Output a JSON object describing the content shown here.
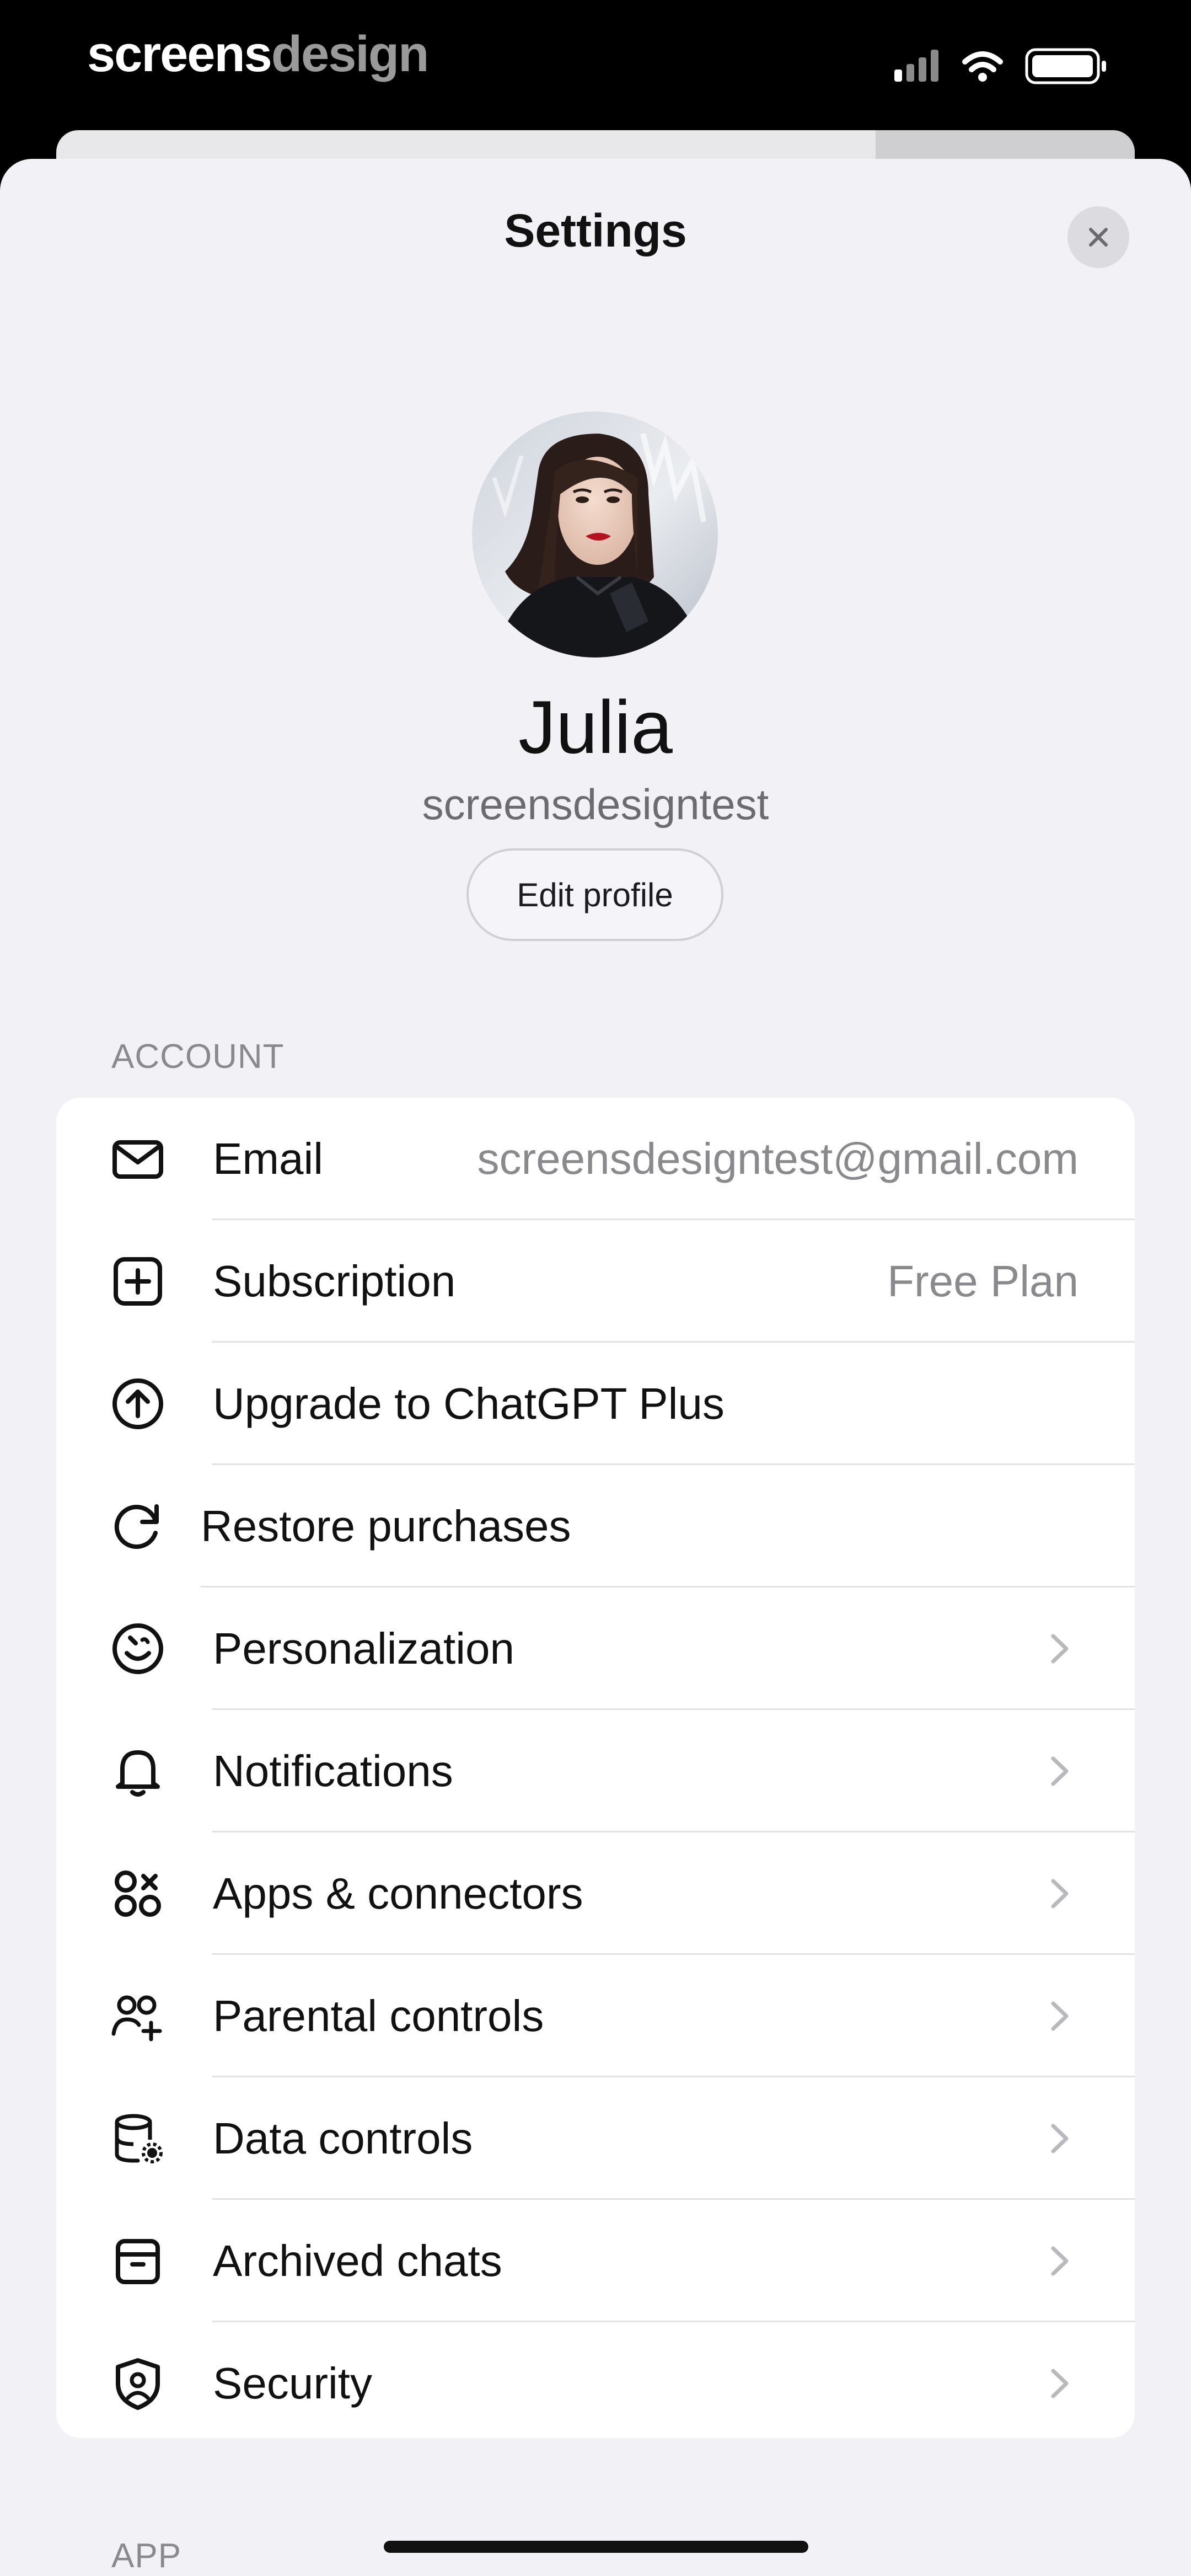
{
  "brand": {
    "part1": "screens",
    "part2": "design"
  },
  "header": {
    "title": "Settings"
  },
  "profile": {
    "name": "Julia",
    "handle": "screensdesigntest",
    "edit_label": "Edit profile"
  },
  "sections": {
    "account": "ACCOUNT",
    "app": "APP"
  },
  "account": {
    "items": [
      {
        "label": "Email",
        "value": "screensdesigntest@gmail.com",
        "icon": "mail-icon"
      },
      {
        "label": "Subscription",
        "value": "Free Plan",
        "icon": "plus-square-icon"
      },
      {
        "label": "Upgrade to ChatGPT Plus",
        "icon": "arrow-up-circle-icon"
      },
      {
        "label": "Restore purchases",
        "icon": "refresh-icon"
      },
      {
        "label": "Personalization",
        "icon": "personalization-icon"
      },
      {
        "label": "Notifications",
        "icon": "bell-icon"
      },
      {
        "label": "Apps & connectors",
        "icon": "apps-icon"
      },
      {
        "label": "Parental controls",
        "icon": "people-add-icon"
      },
      {
        "label": "Data controls",
        "icon": "database-gear-icon"
      },
      {
        "label": "Archived chats",
        "icon": "archive-box-icon"
      },
      {
        "label": "Security",
        "icon": "shield-user-icon"
      }
    ]
  },
  "colors": {
    "sheet_bg": "#f2f1f6",
    "card_bg": "#ffffff",
    "secondary_text": "#8a8a8e"
  }
}
